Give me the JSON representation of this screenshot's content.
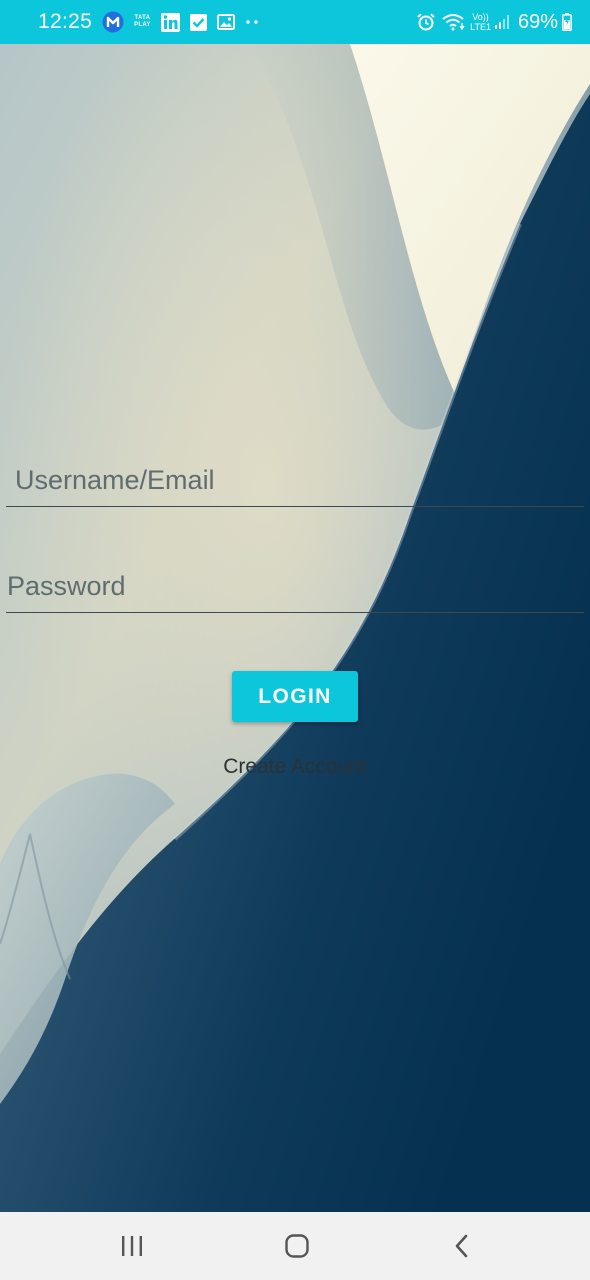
{
  "status_bar": {
    "time": "12:25",
    "battery": "69%",
    "network_label_top": "Vo))",
    "network_label_bottom": "LTE1",
    "tata_play_line1": "TATA",
    "tata_play_line2": "PLAY",
    "left_icons": [
      "meet-app-icon",
      "tata-play-icon",
      "linkedin-icon",
      "checkmark-icon",
      "gallery-icon",
      "more-dots-icon"
    ],
    "right_icons": [
      "alarm-icon",
      "wifi-icon",
      "signal-icon",
      "battery-icon"
    ],
    "color": "#0cc6dc"
  },
  "login_form": {
    "username_placeholder": "Username/Email",
    "password_placeholder": "Password",
    "login_label": "LOGIN",
    "create_account_label": "Create Account",
    "accent_color": "#0cc6dc"
  },
  "nav_bar": {
    "icons": [
      "recent-apps-icon",
      "home-icon",
      "back-icon"
    ]
  }
}
